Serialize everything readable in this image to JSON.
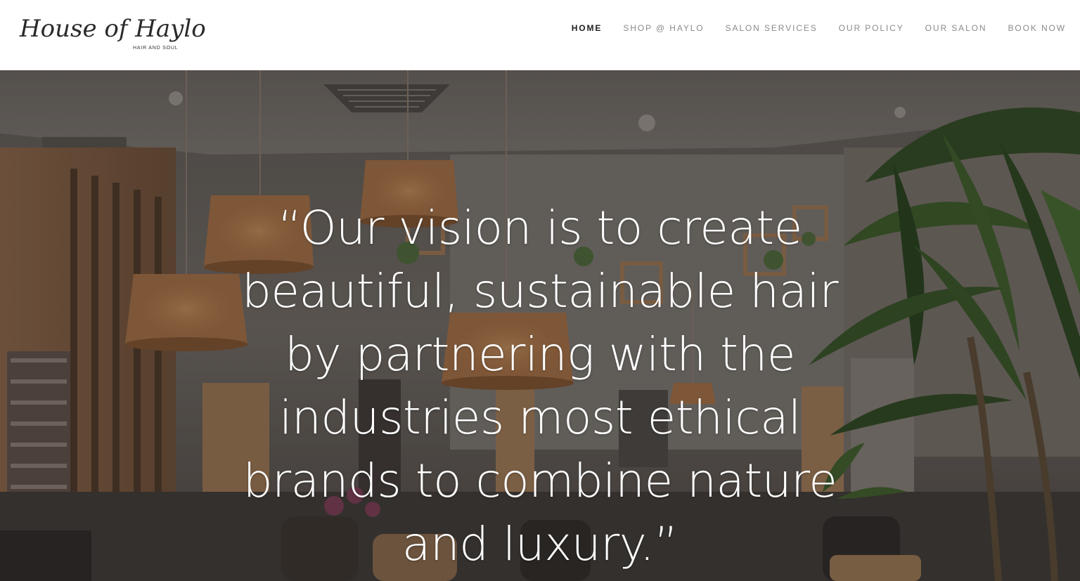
{
  "brand": {
    "name": "House of Haylo",
    "tagline": "HAIR AND SOUL"
  },
  "nav": {
    "items": [
      {
        "label": "HOME",
        "active": true
      },
      {
        "label": "SHOP @ HAYLO",
        "active": false
      },
      {
        "label": "SALON SERVICES",
        "active": false
      },
      {
        "label": "OUR POLICY",
        "active": false
      },
      {
        "label": "OUR SALON",
        "active": false
      },
      {
        "label": "BOOK NOW",
        "active": false
      }
    ]
  },
  "hero": {
    "quote": "“Our vision is to create beautiful, sustainable hair by partnering with the industries most ethical brands to combine nature and luxury.”"
  },
  "colors": {
    "header_bg": "#ffffff",
    "nav_active": "#1e1e1e",
    "nav_inactive": "#8a8a8a",
    "hero_text": "#ffffff"
  }
}
